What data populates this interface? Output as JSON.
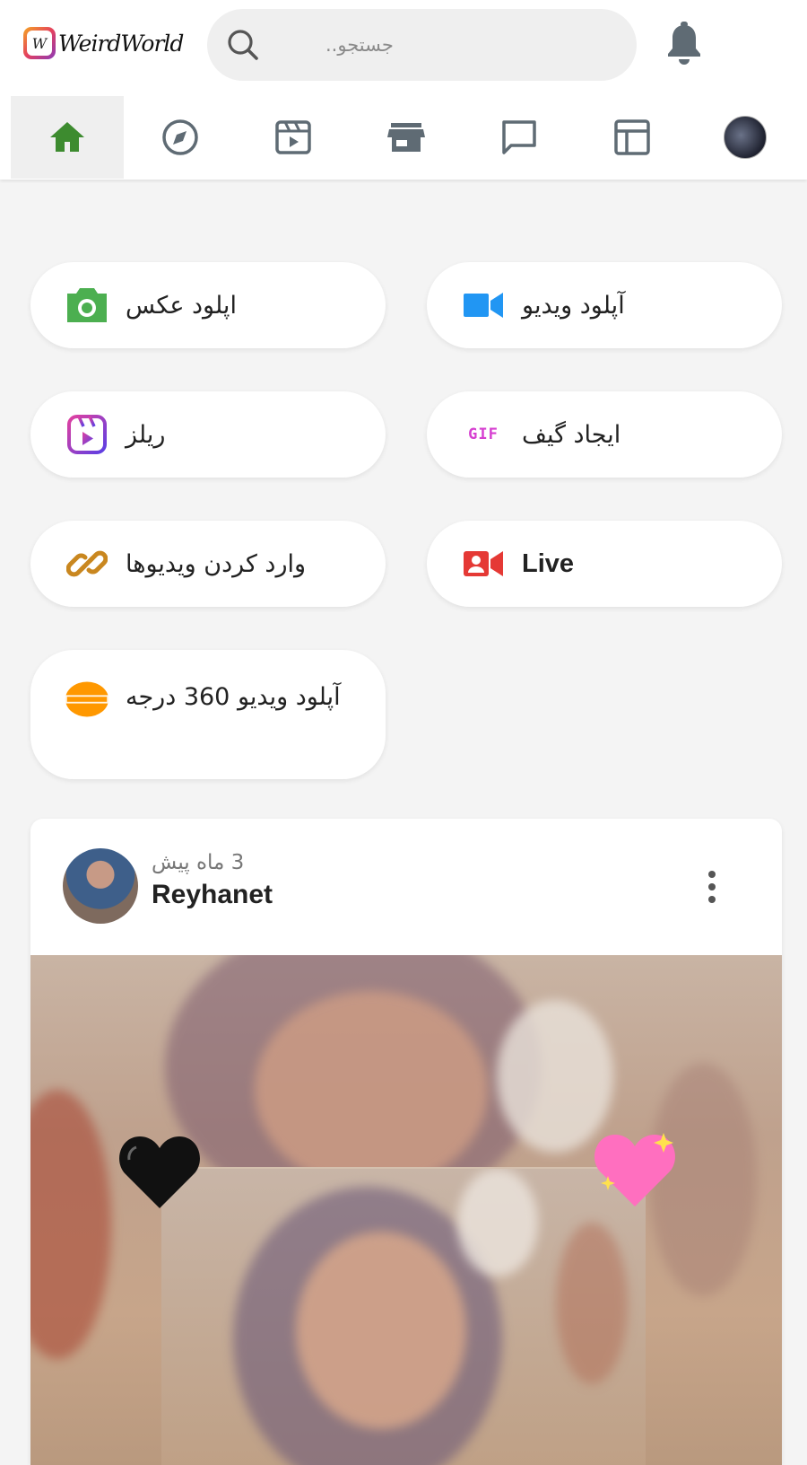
{
  "header": {
    "logo_text": "WeirdWorld",
    "logo_mark_letter": "W",
    "search_placeholder": "جستجو..",
    "notification_icon": "bell-icon"
  },
  "nav": {
    "items": [
      {
        "name": "home",
        "icon": "home-icon",
        "active": true
      },
      {
        "name": "explore",
        "icon": "compass-icon",
        "active": false
      },
      {
        "name": "reels",
        "icon": "reels-icon",
        "active": false
      },
      {
        "name": "market",
        "icon": "store-icon",
        "active": false
      },
      {
        "name": "messages",
        "icon": "chat-icon",
        "active": false
      },
      {
        "name": "layout",
        "icon": "layout-icon",
        "active": false
      },
      {
        "name": "profile",
        "icon": "avatar",
        "active": false
      }
    ],
    "active_color": "#3d8b2f"
  },
  "actions": {
    "upload_photo": "اپلود عکس",
    "upload_video": "آپلود ویدیو",
    "reels": "ریلز",
    "create_gif": "ایجاد گیف",
    "import_videos": "وارد کردن ویدیوها",
    "live": "Live",
    "upload_360": "آپلود ویدیو 360 درجه",
    "gif_badge": "GIF"
  },
  "post": {
    "time": "3 ماه پیش",
    "username": "Reyhanet",
    "more_icon": "more-vertical-icon"
  },
  "colors": {
    "photo_icon": "#4caf50",
    "video_icon": "#2196f3",
    "reels_icon": "#7b3fe4",
    "gif_icon": "#d63fd0",
    "link_icon": "#c9871f",
    "live_icon": "#e53935",
    "v360_icon": "#ff9800"
  }
}
